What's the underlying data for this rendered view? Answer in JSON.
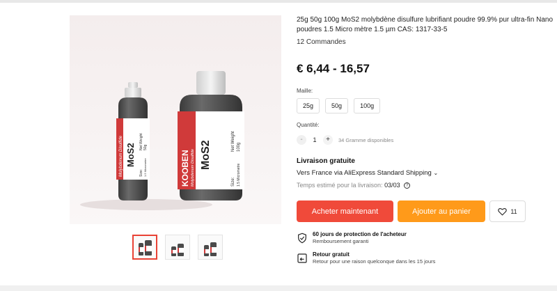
{
  "product": {
    "title": "25g 50g 100g MoS2 molybdène disulfure lubrifiant poudre 99.9% pur ultra-fin Nano poudres 1.5 Micro mètre 1.5 µm CAS: 1317-33-5",
    "orders": "12 Commandes",
    "price": "€ 6,44 - 16,57"
  },
  "image": {
    "brand": "KOOBEN",
    "product_name": "MoS2",
    "subtitle": "Molybdenum Disulfide",
    "small_bottle": {
      "net_weight_label": "Net Weight",
      "net_weight": "50g",
      "size_label": "Size:",
      "size": "1.5 Micrometre"
    },
    "large_bottle": {
      "net_weight_label": "Net Weight",
      "net_weight": "100g",
      "size_label": "Size:",
      "size": "1.5 Micrometre"
    }
  },
  "gallery": {
    "thumbnail_count": 3,
    "active_index": 0
  },
  "variants": {
    "label": "Maille:",
    "options": [
      "25g",
      "50g",
      "100g"
    ]
  },
  "quantity": {
    "label": "Quantité:",
    "minus": "-",
    "value": "1",
    "plus": "+",
    "available": "34 Gramme disponibles"
  },
  "shipping": {
    "title": "Livraison gratuite",
    "destination": "Vers France via AliExpress Standard Shipping",
    "estimate_label": "Temps estimé pour la livraison:",
    "estimate_date": "03/03"
  },
  "actions": {
    "buy_now": "Acheter maintenant",
    "add_to_cart": "Ajouter au panier",
    "wishlist_count": "11"
  },
  "perks": [
    {
      "title": "60 jours de protection de l'acheteur",
      "subtitle": "Remboursement garanti",
      "icon": "shield-check-icon"
    },
    {
      "title": "Retour gratuit",
      "subtitle": "Retour pour une raison quelconque dans les 15 jours",
      "icon": "return-icon"
    }
  ],
  "colors": {
    "buy_button": "#f04a3a",
    "cart_button": "#ff9a1a",
    "label_red": "#d03a3a",
    "bottle_gray": "#4a4a4a"
  }
}
